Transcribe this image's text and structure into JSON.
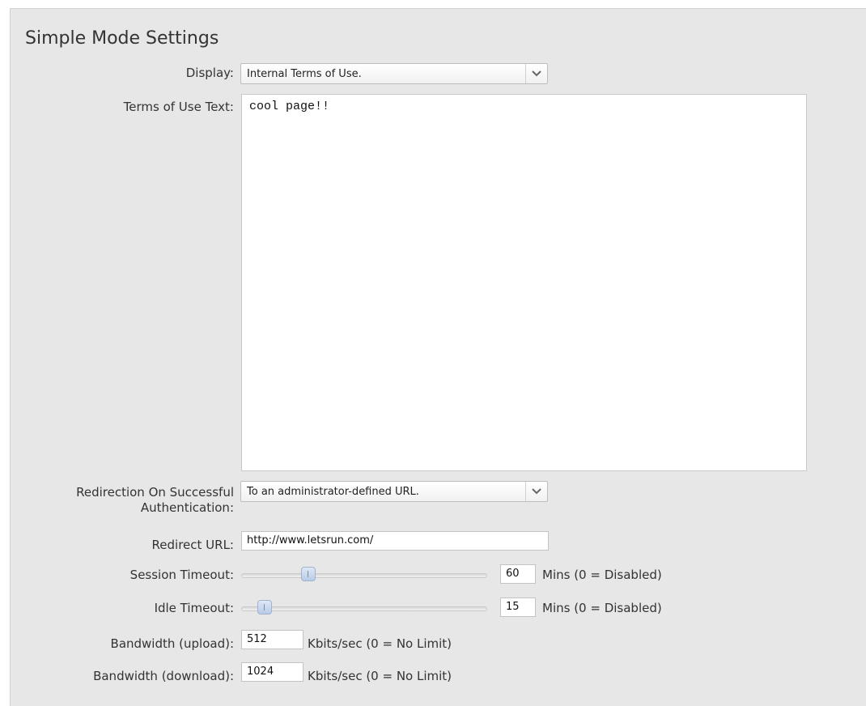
{
  "section": {
    "title": "Simple Mode Settings"
  },
  "display": {
    "label": "Display:",
    "value": "Internal Terms of Use."
  },
  "terms": {
    "label": "Terms of Use Text:",
    "value": "cool page!!"
  },
  "redirection": {
    "label_line1": "Redirection On Successful",
    "label_line2": "Authentication:",
    "value": "To an administrator-defined URL."
  },
  "redirect_url": {
    "label": "Redirect URL:",
    "value": "http://www.letsrun.com/"
  },
  "session_timeout": {
    "label": "Session Timeout:",
    "value": "60",
    "slider_fraction": 0.26,
    "suffix": "Mins (0 = Disabled)"
  },
  "idle_timeout": {
    "label": "Idle Timeout:",
    "value": "15",
    "slider_fraction": 0.07,
    "suffix": "Mins (0 = Disabled)"
  },
  "bandwidth_upload": {
    "label": "Bandwidth (upload):",
    "value": "512",
    "suffix": "Kbits/sec (0 = No Limit)"
  },
  "bandwidth_download": {
    "label": "Bandwidth (download):",
    "value": "1024",
    "suffix": "Kbits/sec (0 = No Limit)"
  },
  "icons": {
    "dropdown": "chevron-down-icon",
    "slider": "slider-handle"
  }
}
